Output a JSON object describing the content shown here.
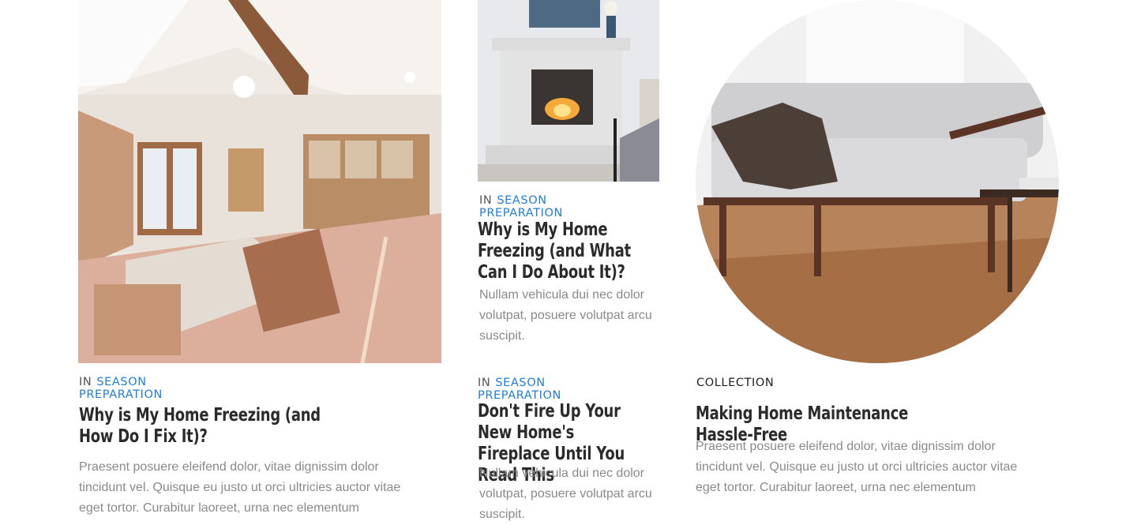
{
  "colors": {
    "accent": "#1f7fd6",
    "title": "#2b2b2b",
    "text_muted": "#8a8a8a",
    "meta_prefix": "#555555"
  },
  "cards": [
    {
      "category_prefix": "IN",
      "category": "SEASON PREPARATION",
      "title": "Why is My Home Freezing (and How Do I Fix It)?",
      "excerpt": "Praesent posuere eleifend dolor, vitae dignissim dolor tincidunt vel. Quisque eu justo ut orci ultricies auctor vitae eget tortor. Curabitur laoreet, urna nec elementum",
      "image": "renovation-room-photo"
    },
    {
      "category_prefix": "IN",
      "category": "SEASON PREPARATION",
      "title": "Why is My Home Freezing (and What Can I Do About It)?",
      "excerpt": "Nullam vehicula dui nec dolor volutpat, posuere volutpat arcu suscipit.",
      "image": "fireplace-photo"
    },
    {
      "category_prefix": "IN",
      "category": "SEASON PREPARATION",
      "title": "Don't Fire Up Your New Home's Fireplace Until You Read This",
      "excerpt": "Nullam vehicula dui nec dolor volutpat, posuere volutpat arcu suscipit."
    },
    {
      "category_prefix": "",
      "category": "COLLECTION",
      "title": "Making Home Maintenance Hassle-Free",
      "excerpt": "Praesent posuere eleifend dolor, vitae dignissim dolor tincidunt vel. Quisque eu justo ut orci ultricies auctor vitae eget tortor. Curabitur laoreet, urna nec elementum",
      "image": "sofa-living-room-photo"
    }
  ]
}
